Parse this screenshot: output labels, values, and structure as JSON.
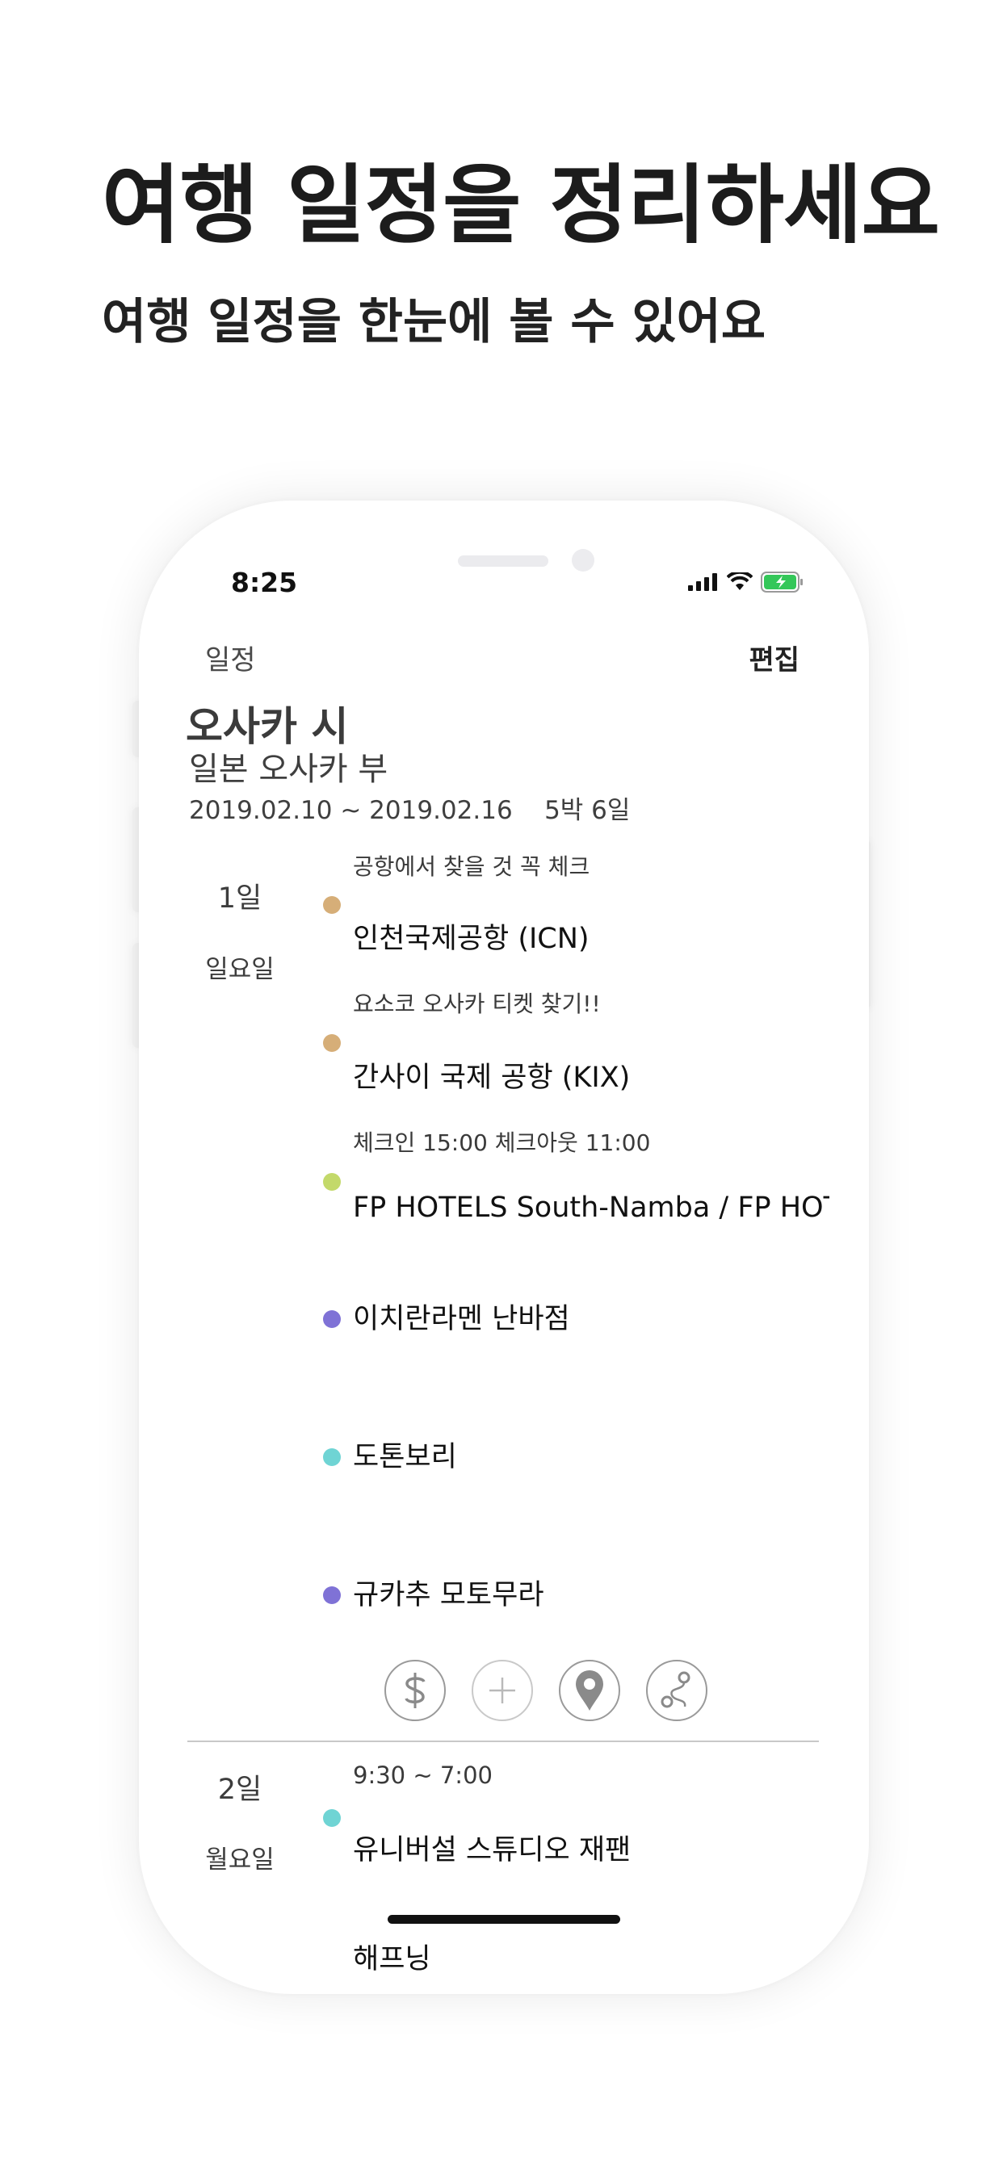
{
  "headline": "여행 일정을 정리하세요",
  "subheadline": "여행 일정을 한눈에 볼 수 있어요",
  "status_bar": {
    "time": "8:25"
  },
  "nav": {
    "back_label": "일정",
    "edit_label": "편집"
  },
  "trip": {
    "city": "오사카 시",
    "region": "일본 오사카 부",
    "dates": "2019.02.10 ~ 2019.02.16    5박 6일"
  },
  "days": [
    {
      "day": "1일",
      "weekday": "일요일",
      "items": [
        {
          "note": "공항에서 찾을 것 꼭 체크",
          "name": "인천국제공항 (ICN)",
          "color": "#d6ae78"
        },
        {
          "note": "요소코 오사카 티켓 찾기!!",
          "name": "간사이 국제 공항 (KIX)",
          "color": "#d6ae78"
        },
        {
          "note": "체크인 15:00 체크아웃 11:00",
          "name": "FP HOTELS South-Namba / FP HOT...",
          "color": "#c3d96a"
        },
        {
          "note": "",
          "name": "이치란라멘 난바점",
          "color": "#7f72d6"
        },
        {
          "note": "",
          "name": "도톤보리",
          "color": "#6fd4d4"
        },
        {
          "note": "",
          "name": "규카추 모토무라",
          "color": "#7f72d6"
        }
      ]
    },
    {
      "day": "2일",
      "weekday": "월요일",
      "items": [
        {
          "note": "9:30 ~ 7:00",
          "name": "유니버설 스튜디오 재팬",
          "color": "#6fd4d4"
        }
      ]
    }
  ],
  "toolbar": {
    "icons": [
      "dollar-icon",
      "plus-icon",
      "map-pin-icon",
      "route-icon"
    ]
  },
  "peek_text": "해프닝"
}
